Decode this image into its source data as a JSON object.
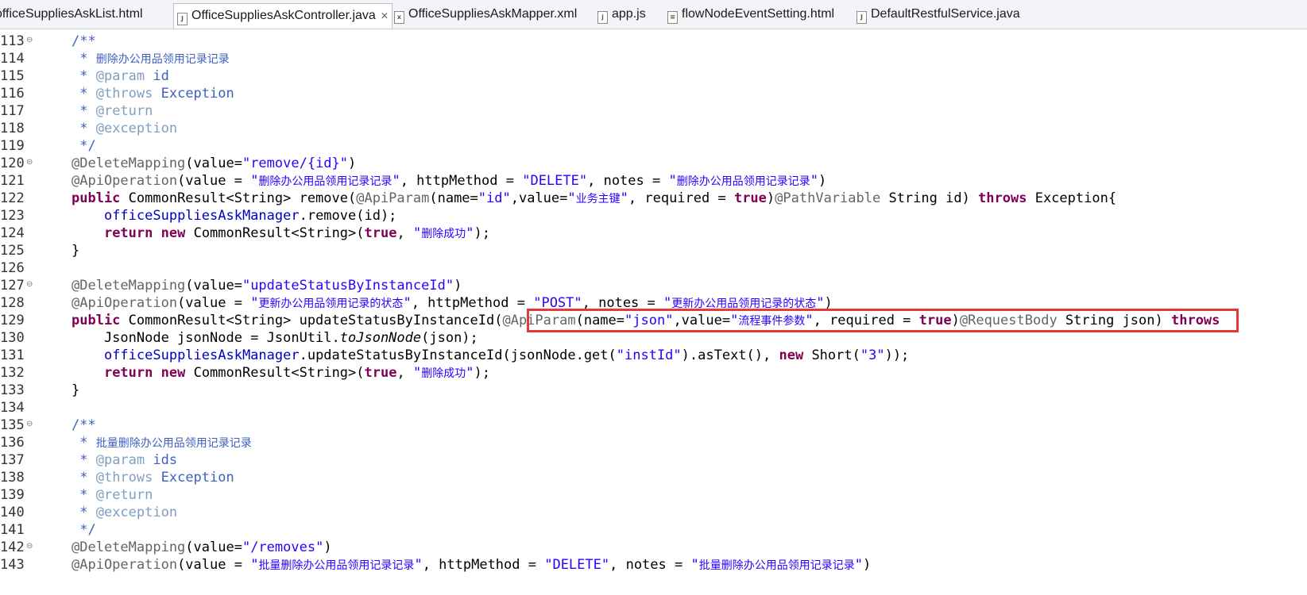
{
  "tabs": [
    {
      "label": "officeSuppliesAskList.html",
      "type": "html"
    },
    {
      "label": "OfficeSuppliesAskController.java",
      "type": "java",
      "active": true
    },
    {
      "label": "OfficeSuppliesAskMapper.xml",
      "type": "xml"
    },
    {
      "label": "app.js",
      "type": "js"
    },
    {
      "label": "flowNodeEventSetting.html",
      "type": "html"
    },
    {
      "label": "DefaultRestfulService.java",
      "type": "java"
    }
  ],
  "editor": {
    "line_numbers": [
      "113",
      "114",
      "115",
      "116",
      "117",
      "118",
      "119",
      "120",
      "121",
      "122",
      "123",
      "124",
      "125",
      "126",
      "127",
      "128",
      "129",
      "130",
      "131",
      "132",
      "133",
      "134",
      "135",
      "136",
      "137",
      "138",
      "139",
      "140",
      "141",
      "142",
      "143"
    ],
    "fold_markers": [
      "113",
      "120",
      "127",
      "135",
      "142"
    ],
    "lines": [
      [
        [
          "c",
          "/**"
        ]
      ],
      [
        [
          "c",
          " * "
        ],
        [
          "c zh",
          "删除办公用品领用记录记录"
        ]
      ],
      [
        [
          "c",
          " * "
        ],
        [
          "tag",
          "@param"
        ],
        [
          "c",
          " id"
        ]
      ],
      [
        [
          "c",
          " * "
        ],
        [
          "tag",
          "@throws"
        ],
        [
          "c",
          " Exception"
        ]
      ],
      [
        [
          "c",
          " * "
        ],
        [
          "tag",
          "@return"
        ]
      ],
      [
        [
          "c",
          " * "
        ],
        [
          "tag",
          "@exception"
        ]
      ],
      [
        [
          "c",
          " */"
        ]
      ],
      [
        [
          "an",
          "@DeleteMapping"
        ],
        [
          "",
          "(value="
        ],
        [
          "s",
          "\"remove/{id}\""
        ],
        [
          "",
          ")"
        ]
      ],
      [
        [
          "an",
          "@ApiOperation"
        ],
        [
          "",
          "(value = "
        ],
        [
          "s",
          "\""
        ],
        [
          "s zh",
          "删除办公用品领用记录记录"
        ],
        [
          "s",
          "\""
        ],
        [
          "",
          ", httpMethod = "
        ],
        [
          "s",
          "\"DELETE\""
        ],
        [
          "",
          ", notes = "
        ],
        [
          "s",
          "\""
        ],
        [
          "s zh",
          "删除办公用品领用记录记录"
        ],
        [
          "s",
          "\""
        ],
        [
          "",
          ")"
        ]
      ],
      [
        [
          "k",
          "public"
        ],
        [
          "",
          " CommonResult<String> remove("
        ],
        [
          "an",
          "@ApiParam"
        ],
        [
          "",
          "(name="
        ],
        [
          "s",
          "\"id\""
        ],
        [
          "",
          ",value="
        ],
        [
          "s",
          "\""
        ],
        [
          "s zh",
          "业务主键"
        ],
        [
          "s",
          "\""
        ],
        [
          "",
          ", required = "
        ],
        [
          "k",
          "true"
        ],
        [
          "",
          ")"
        ],
        [
          "an",
          "@PathVariable"
        ],
        [
          "",
          " String id) "
        ],
        [
          "k",
          "throws"
        ],
        [
          "",
          " Exception{"
        ]
      ],
      [
        [
          "",
          "    "
        ],
        [
          "f",
          "officeSuppliesAskManager"
        ],
        [
          "",
          ".remove(id);"
        ]
      ],
      [
        [
          "",
          "    "
        ],
        [
          "k",
          "return"
        ],
        [
          "",
          " "
        ],
        [
          "k",
          "new"
        ],
        [
          "",
          " CommonResult<String>("
        ],
        [
          "k",
          "true"
        ],
        [
          "",
          ", "
        ],
        [
          "s",
          "\""
        ],
        [
          "s zh",
          "删除成功"
        ],
        [
          "s",
          "\""
        ],
        [
          "",
          ");"
        ]
      ],
      [
        [
          "",
          "}"
        ]
      ],
      [],
      [
        [
          "an",
          "@DeleteMapping"
        ],
        [
          "",
          "(value="
        ],
        [
          "s",
          "\"updateStatusByInstanceId\""
        ],
        [
          "",
          ")"
        ]
      ],
      [
        [
          "an",
          "@ApiOperation"
        ],
        [
          "",
          "(value = "
        ],
        [
          "s",
          "\""
        ],
        [
          "s zh",
          "更新办公用品领用记录的状态"
        ],
        [
          "s",
          "\""
        ],
        [
          "",
          ", httpMethod = "
        ],
        [
          "s",
          "\"POST\""
        ],
        [
          "",
          ", notes = "
        ],
        [
          "s",
          "\""
        ],
        [
          "s zh",
          "更新办公用品领用记录的状态"
        ],
        [
          "s",
          "\""
        ],
        [
          "",
          ")"
        ]
      ],
      [
        [
          "k",
          "public"
        ],
        [
          "",
          " CommonResult<String> updateStatusByInstanceId("
        ],
        [
          "an",
          "@ApiParam"
        ],
        [
          "",
          "(name="
        ],
        [
          "s",
          "\"json\""
        ],
        [
          "",
          ",value="
        ],
        [
          "s",
          "\""
        ],
        [
          "s zh",
          "流程事件参数"
        ],
        [
          "s",
          "\""
        ],
        [
          "",
          ", required = "
        ],
        [
          "k",
          "true"
        ],
        [
          "",
          ")"
        ],
        [
          "an",
          "@RequestBody"
        ],
        [
          "",
          " String json) "
        ],
        [
          "k",
          "throws"
        ]
      ],
      [
        [
          "",
          "    JsonNode jsonNode = JsonUtil."
        ],
        [
          "it",
          "toJsonNode"
        ],
        [
          "",
          "(json);"
        ]
      ],
      [
        [
          "",
          "    "
        ],
        [
          "f",
          "officeSuppliesAskManager"
        ],
        [
          "",
          ".updateStatusByInstanceId(jsonNode.get("
        ],
        [
          "s",
          "\"instId\""
        ],
        [
          "",
          ").asText(), "
        ],
        [
          "k",
          "new"
        ],
        [
          "",
          " Short("
        ],
        [
          "s",
          "\"3\""
        ],
        [
          "",
          "));"
        ]
      ],
      [
        [
          "",
          "    "
        ],
        [
          "k",
          "return"
        ],
        [
          "",
          " "
        ],
        [
          "k",
          "new"
        ],
        [
          "",
          " CommonResult<String>("
        ],
        [
          "k",
          "true"
        ],
        [
          "",
          ", "
        ],
        [
          "s",
          "\""
        ],
        [
          "s zh",
          "删除成功"
        ],
        [
          "s",
          "\""
        ],
        [
          "",
          ");"
        ]
      ],
      [
        [
          "",
          "}"
        ]
      ],
      [],
      [
        [
          "c",
          "/**"
        ]
      ],
      [
        [
          "c",
          " * "
        ],
        [
          "c zh",
          "批量删除办公用品领用记录记录"
        ]
      ],
      [
        [
          "c",
          " * "
        ],
        [
          "tag",
          "@param"
        ],
        [
          "c",
          " ids"
        ]
      ],
      [
        [
          "c",
          " * "
        ],
        [
          "tag",
          "@throws"
        ],
        [
          "c",
          " Exception"
        ]
      ],
      [
        [
          "c",
          " * "
        ],
        [
          "tag",
          "@return"
        ]
      ],
      [
        [
          "c",
          " * "
        ],
        [
          "tag",
          "@exception"
        ]
      ],
      [
        [
          "c",
          " */"
        ]
      ],
      [
        [
          "an",
          "@DeleteMapping"
        ],
        [
          "",
          "(value="
        ],
        [
          "s",
          "\"/removes\""
        ],
        [
          "",
          ")"
        ]
      ],
      [
        [
          "an",
          "@ApiOperation"
        ],
        [
          "",
          "(value = "
        ],
        [
          "s",
          "\""
        ],
        [
          "s zh",
          "批量删除办公用品领用记录记录"
        ],
        [
          "s",
          "\""
        ],
        [
          "",
          ", httpMethod = "
        ],
        [
          "s",
          "\"DELETE\""
        ],
        [
          "",
          ", notes = "
        ],
        [
          "s",
          "\""
        ],
        [
          "s zh",
          "批量删除办公用品领用记录记录"
        ],
        [
          "s",
          "\""
        ],
        [
          "",
          ")"
        ]
      ]
    ]
  },
  "colors": {
    "comment": "#3f5fbf",
    "javadoc_tag": "#7f9fbf",
    "annotation": "#646464",
    "keyword": "#7f0055",
    "string": "#2a00ff",
    "field": "#0000c0",
    "highlight_box": "#e53a3a"
  }
}
